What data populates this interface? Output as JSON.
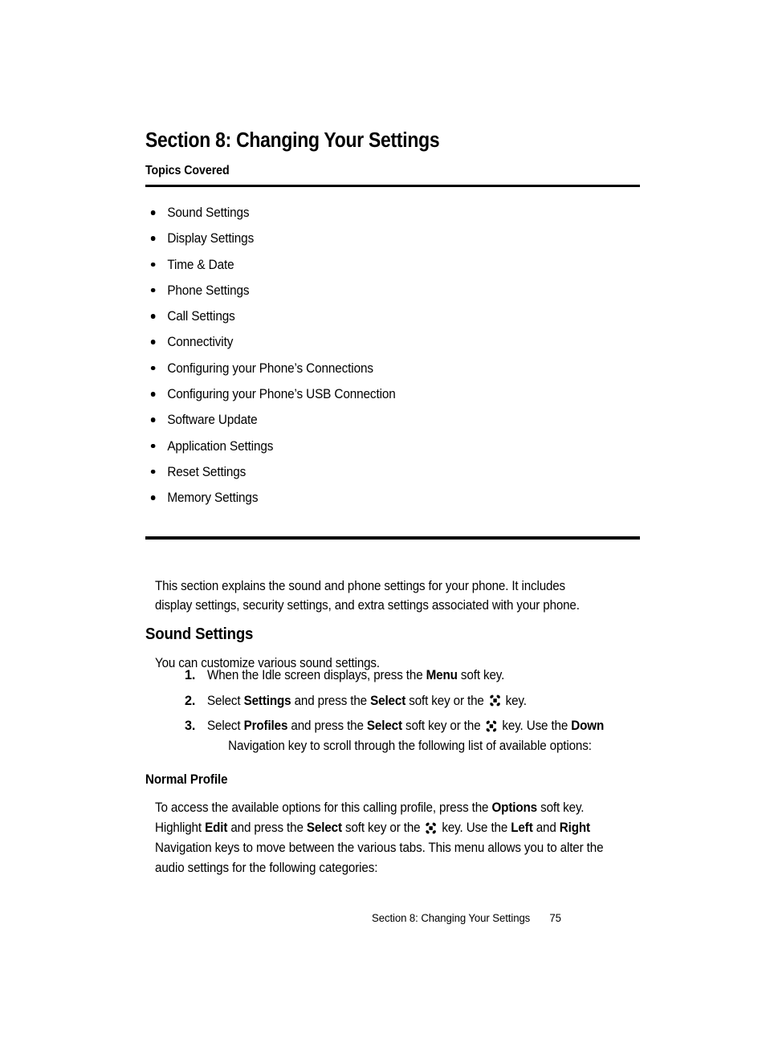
{
  "document": {
    "section_title": "Section 8: Changing Your Settings",
    "topics_label": "Topics Covered",
    "topics": [
      "Sound Settings",
      "Display Settings",
      "Time & Date",
      "Phone Settings",
      "Call Settings",
      "Connectivity",
      "Configuring your Phone’s Connections",
      "Configuring your Phone’s USB Connection",
      "Software Update",
      "Application Settings",
      "Reset Settings",
      "Memory Settings"
    ],
    "intro_paragraph": "This section explains the sound and phone settings for your phone. It includes display settings, security settings, and extra settings associated with your phone.",
    "sound_settings": {
      "heading": "Sound Settings",
      "lead": "You can customize various sound settings.",
      "steps": [
        {
          "number": "1.",
          "parts": [
            {
              "type": "text",
              "value": "When the Idle screen displays, press the "
            },
            {
              "type": "bold",
              "value": "Menu"
            },
            {
              "type": "text",
              "value": " soft key."
            }
          ]
        },
        {
          "number": "2.",
          "parts": [
            {
              "type": "text",
              "value": "Select "
            },
            {
              "type": "bold",
              "value": "Settings"
            },
            {
              "type": "text",
              "value": " and press the "
            },
            {
              "type": "bold",
              "value": "Select"
            },
            {
              "type": "text",
              "value": " soft key or the "
            },
            {
              "type": "icon",
              "value": "navigation-ok-key-icon"
            },
            {
              "type": "text",
              "value": " key."
            }
          ]
        },
        {
          "number": "3.",
          "parts": [
            {
              "type": "text",
              "value": "Select "
            },
            {
              "type": "bold",
              "value": "Profiles"
            },
            {
              "type": "text",
              "value": " and press the "
            },
            {
              "type": "bold",
              "value": "Select"
            },
            {
              "type": "text",
              "value": " soft key or the "
            },
            {
              "type": "icon",
              "value": "navigation-ok-key-icon"
            },
            {
              "type": "text",
              "value": " key. Use the "
            },
            {
              "type": "bold",
              "value": "Down"
            }
          ],
          "continuation": [
            {
              "type": "text",
              "value": "Navigation key to scroll through the following list of available options:"
            }
          ]
        }
      ]
    },
    "normal_profile": {
      "heading": "Normal Profile",
      "parts": [
        {
          "type": "text",
          "value": "To access the available options for this calling profile, press the "
        },
        {
          "type": "bold",
          "value": "Options"
        },
        {
          "type": "text",
          "value": " soft key. Highlight "
        },
        {
          "type": "bold",
          "value": "Edit"
        },
        {
          "type": "text",
          "value": " and press the "
        },
        {
          "type": "bold",
          "value": "Select"
        },
        {
          "type": "text",
          "value": " soft key or the "
        },
        {
          "type": "icon",
          "value": "navigation-ok-key-icon"
        },
        {
          "type": "text",
          "value": " key. Use the "
        },
        {
          "type": "bold",
          "value": "Left"
        },
        {
          "type": "text",
          "value": " and "
        },
        {
          "type": "bold",
          "value": "Right"
        },
        {
          "type": "text",
          "value": " Navigation keys to move between the various tabs. This menu allows you to alter the audio settings for the following categories:"
        }
      ]
    },
    "footer": {
      "section_label": "Section 8: Changing Your Settings",
      "page_number": "75"
    },
    "colors": {
      "text": "#000000",
      "background": "#ffffff",
      "rule": "#000000"
    }
  }
}
